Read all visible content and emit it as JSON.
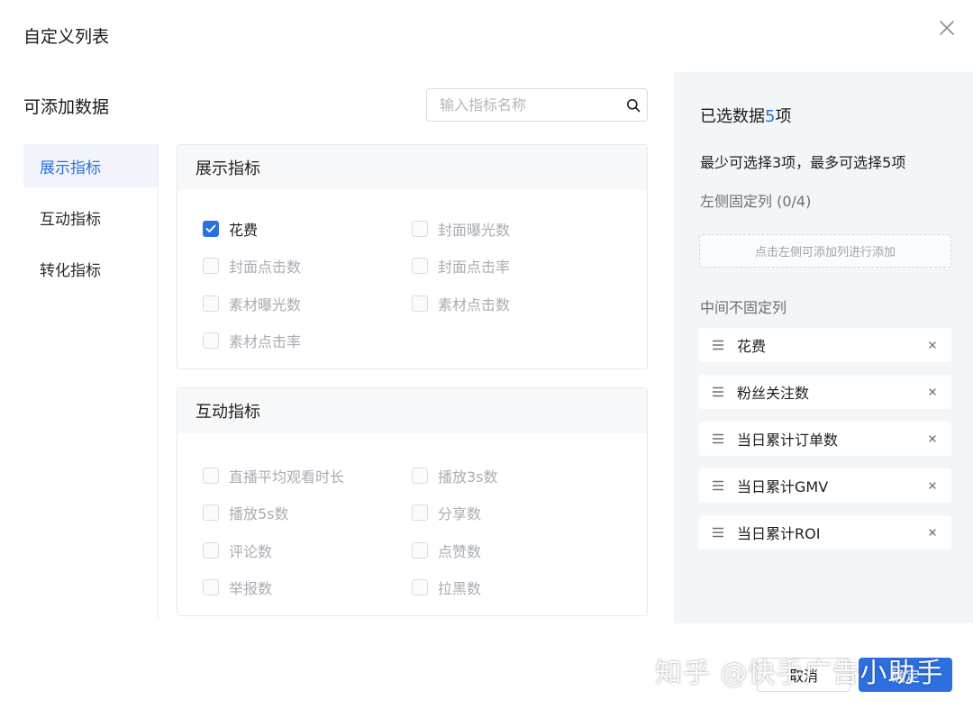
{
  "dialog": {
    "title": "自定义列表"
  },
  "available": {
    "section_title": "可添加数据",
    "search": {
      "placeholder": "输入指标名称",
      "value": ""
    },
    "nav": [
      {
        "label": "展示指标",
        "active": true
      },
      {
        "label": "互动指标",
        "active": false
      },
      {
        "label": "转化指标",
        "active": false
      }
    ],
    "groups": [
      {
        "title": "展示指标",
        "items": [
          {
            "label": "花费",
            "checked": true
          },
          {
            "label": "封面曝光数",
            "checked": false
          },
          {
            "label": "封面点击数",
            "checked": false
          },
          {
            "label": "封面点击率",
            "checked": false
          },
          {
            "label": "素材曝光数",
            "checked": false
          },
          {
            "label": "素材点击数",
            "checked": false
          },
          {
            "label": "素材点击率",
            "checked": false
          }
        ]
      },
      {
        "title": "互动指标",
        "items": [
          {
            "label": "直播平均观看时长",
            "checked": false
          },
          {
            "label": "播放3s数",
            "checked": false
          },
          {
            "label": "播放5s数",
            "checked": false
          },
          {
            "label": "分享数",
            "checked": false
          },
          {
            "label": "评论数",
            "checked": false
          },
          {
            "label": "点赞数",
            "checked": false
          },
          {
            "label": "举报数",
            "checked": false
          },
          {
            "label": "拉黑数",
            "checked": false
          }
        ]
      }
    ]
  },
  "selected": {
    "title_prefix": "已选数据",
    "count": "5",
    "title_suffix": "项",
    "hint": "最少可选择3项，最多可选择5项",
    "fixed_label": "左侧固定列 (0/4)",
    "drop_zone_text": "点击左侧可添加列进行添加",
    "middle_label": "中间不固定列",
    "items": [
      "花费",
      "粉丝关注数",
      "当日累计订单数",
      "当日累计GMV",
      "当日累计ROI"
    ]
  },
  "footer": {
    "cancel_label": "取消",
    "ok_label": "确定"
  },
  "watermark": "知乎 @快手广告小助手",
  "colors": {
    "accent": "#2c6fe0",
    "panel_bg": "#f3f6f9",
    "muted_text": "#a8adb3"
  }
}
